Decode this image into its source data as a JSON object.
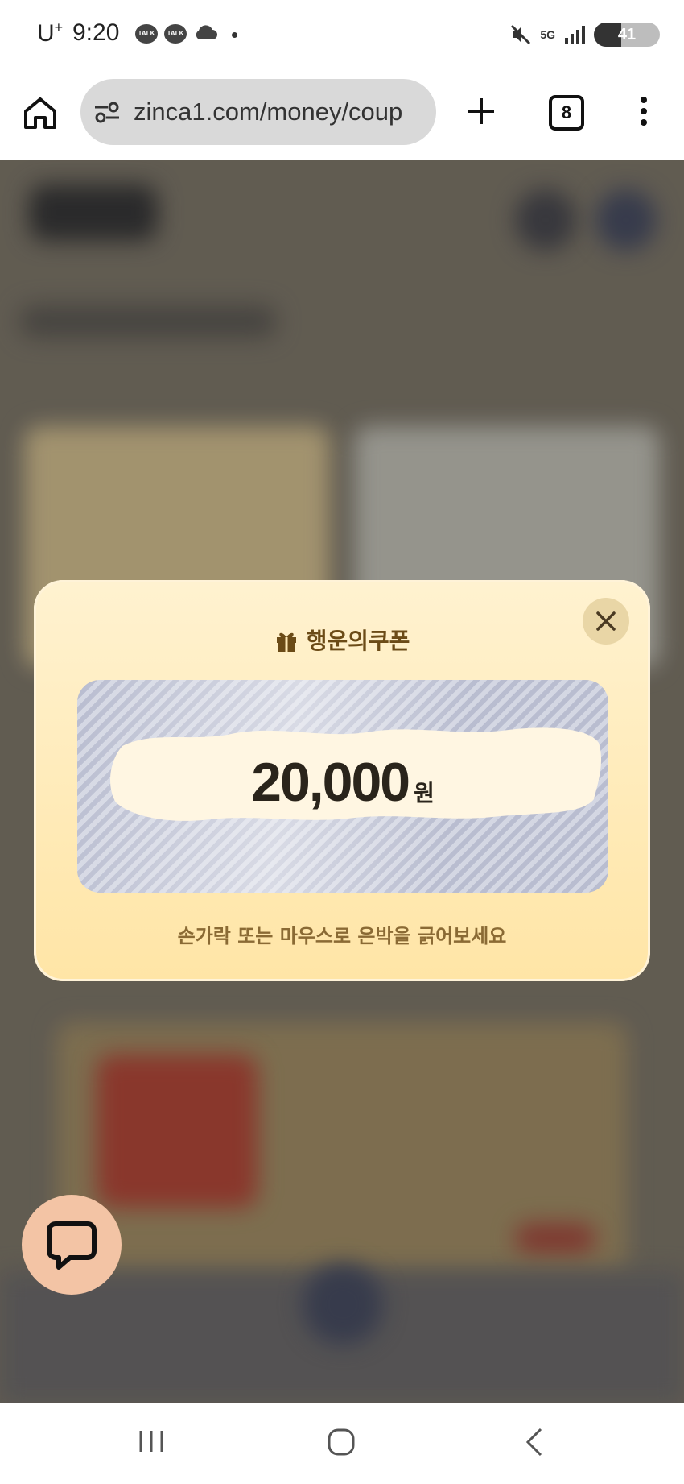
{
  "status_bar": {
    "carrier": "U",
    "carrier_sup": "+",
    "time": "9:20",
    "talk_label": "TALK",
    "network": "5G",
    "battery": "41"
  },
  "browser": {
    "url": "zinca1.com/money/coup",
    "tab_count": "8"
  },
  "popup": {
    "title": "행운의쿠폰",
    "amount": "20,000",
    "unit": "원",
    "hint": "손가락 또는 마우스로 은박을 긁어보세요"
  },
  "colors": {
    "accent_text": "#6b4b17",
    "popup_bg": "#ffe5a6",
    "chat_fab": "#f3c4a5"
  }
}
